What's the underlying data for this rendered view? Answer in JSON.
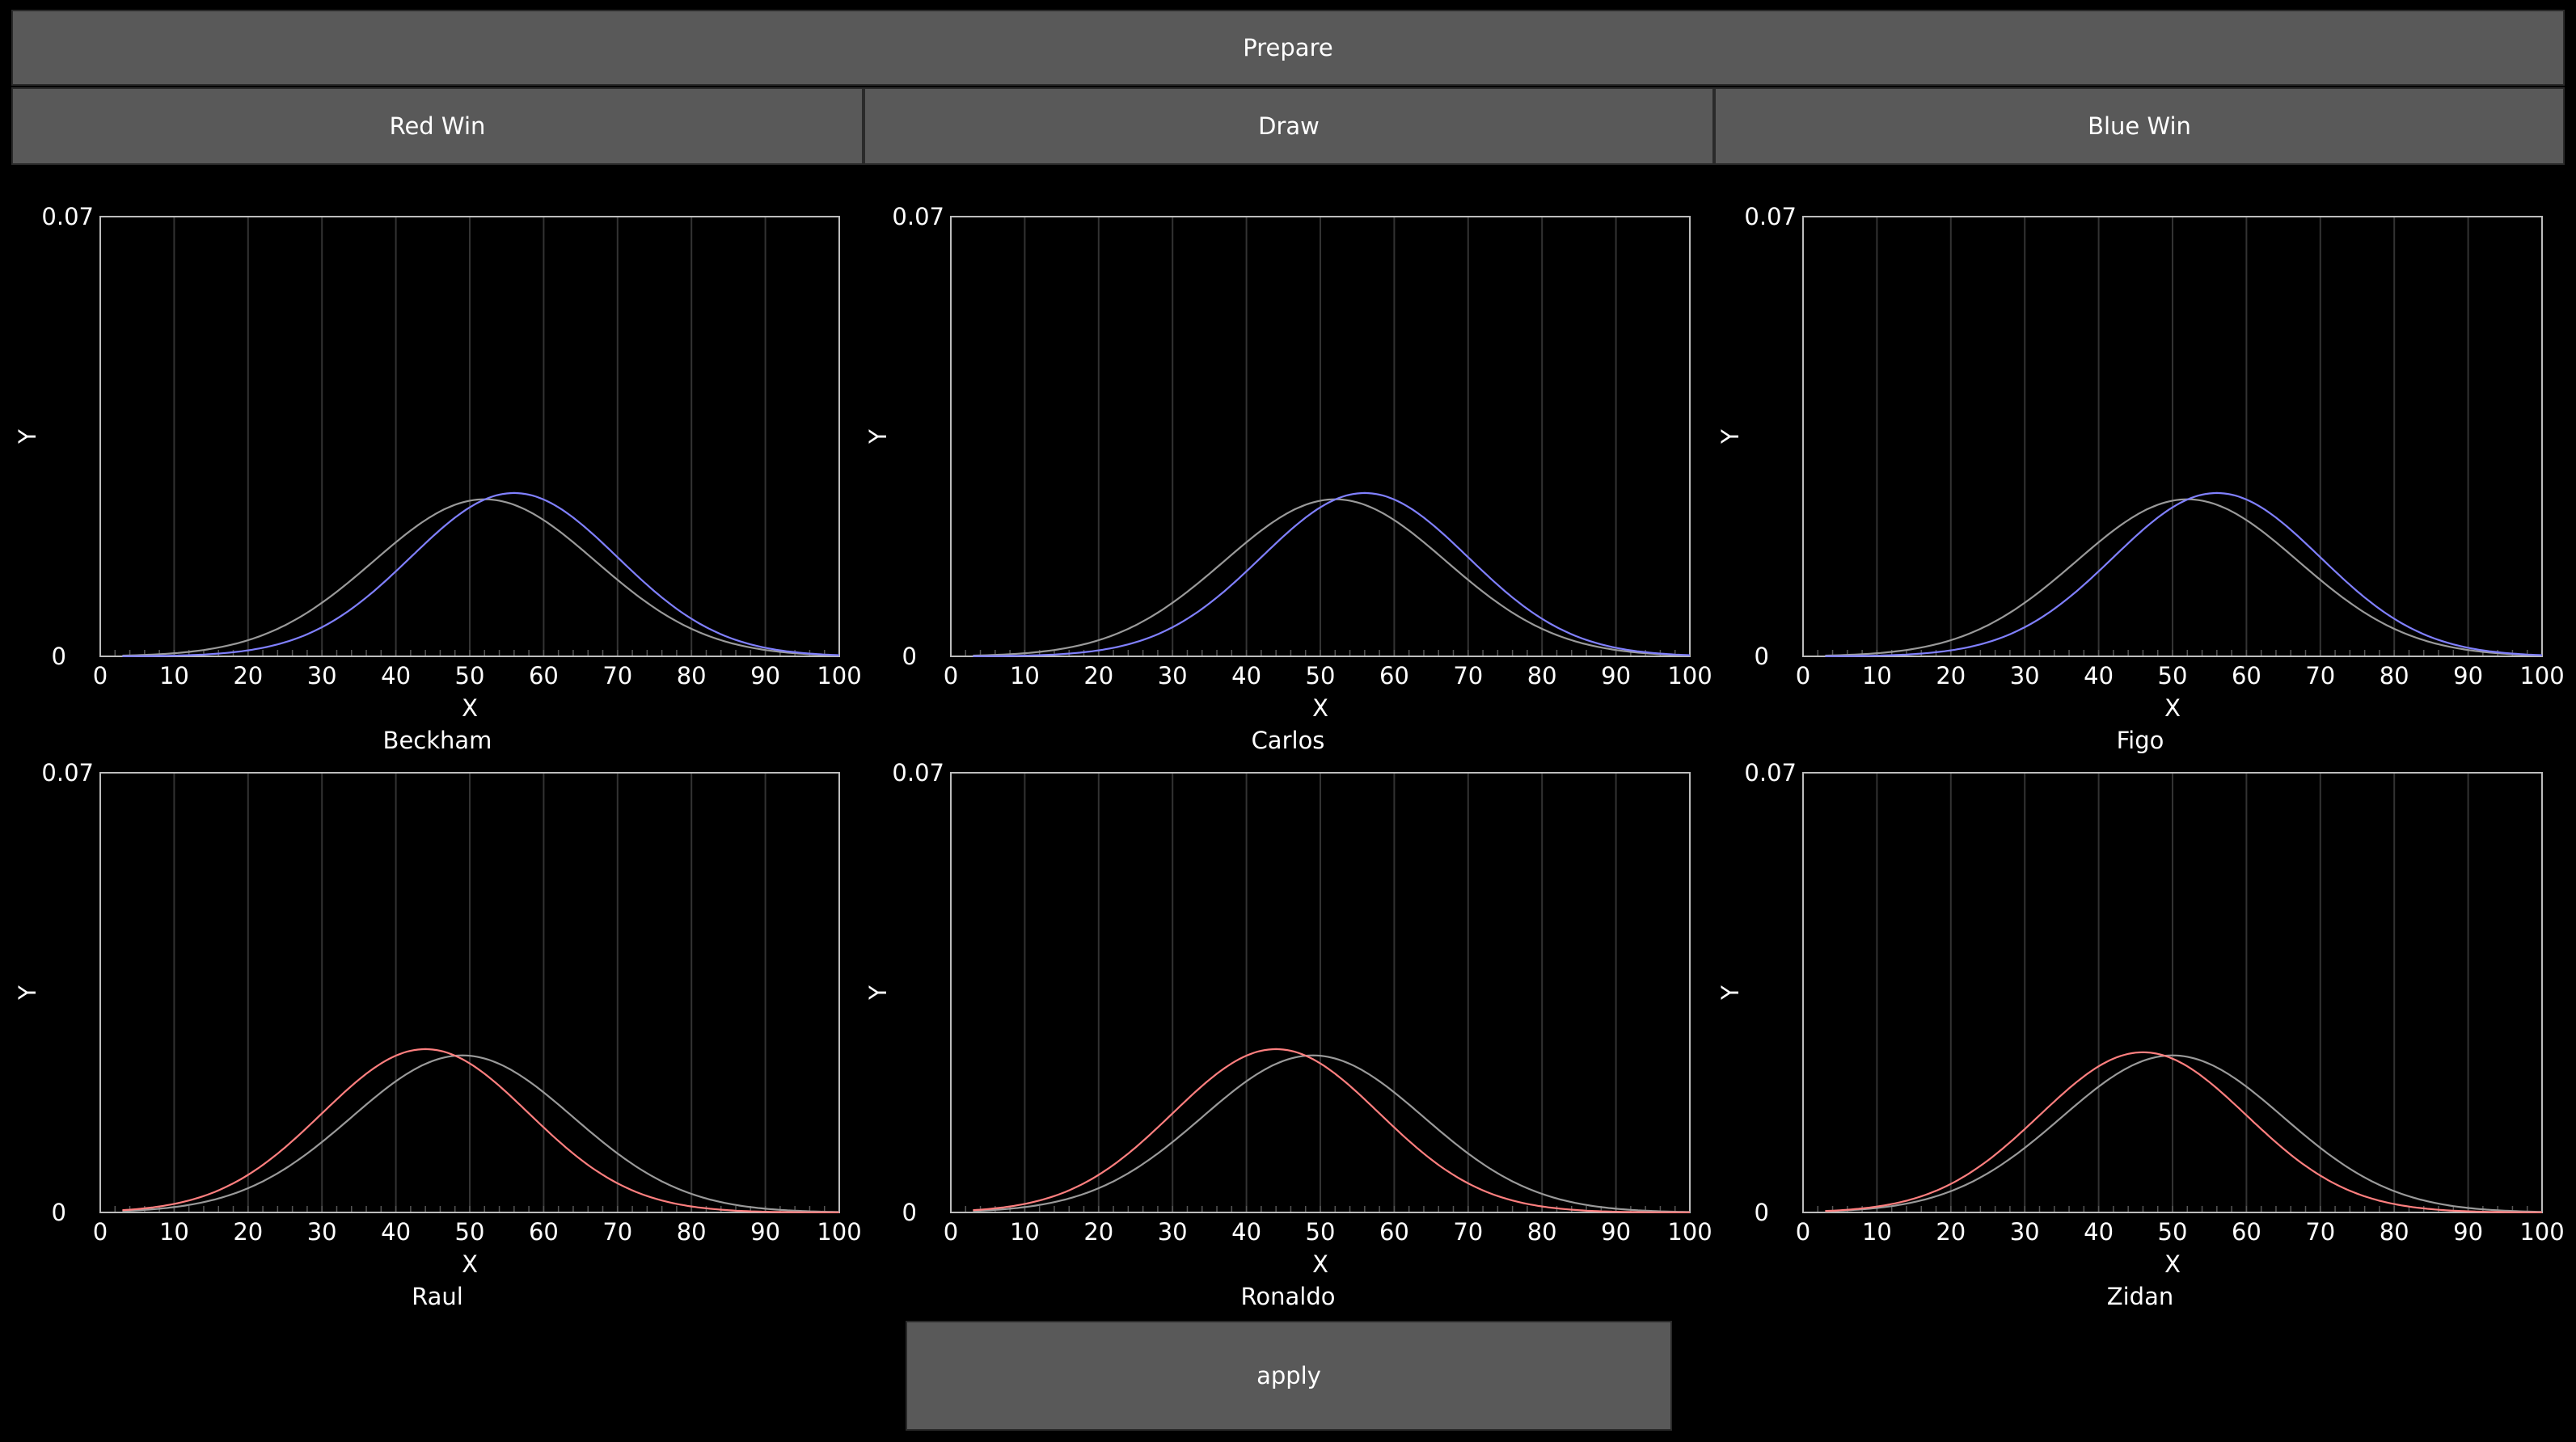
{
  "buttons": {
    "prepare": "Prepare",
    "red_win": "Red Win",
    "draw": "Draw",
    "blue_win": "Blue Win",
    "apply": "apply"
  },
  "colors": {
    "background": "#000000",
    "button_bg": "#595959",
    "gray_curve": "#9a9a9a",
    "blue_curve": "#8080ff",
    "red_curve": "#ff7f7f",
    "axis": "#bdbdbd",
    "grid": "#333333"
  },
  "chart_data": [
    {
      "type": "line",
      "title": "Beckham",
      "xlabel": "X",
      "ylabel": "Y",
      "xlim": [
        0,
        100
      ],
      "ylim": [
        0,
        0.07
      ],
      "x_ticks": [
        "0",
        "10",
        "20",
        "30",
        "40",
        "50",
        "60",
        "70",
        "80",
        "90",
        "100"
      ],
      "y_ticks": [
        "0",
        "0.07"
      ],
      "series": [
        {
          "color": "gray",
          "mean": 52,
          "sd": 15,
          "peak": 0.025
        },
        {
          "color": "blue",
          "mean": 56,
          "sd": 14,
          "peak": 0.026
        }
      ]
    },
    {
      "type": "line",
      "title": "Carlos",
      "xlabel": "X",
      "ylabel": "Y",
      "xlim": [
        0,
        100
      ],
      "ylim": [
        0,
        0.07
      ],
      "x_ticks": [
        "0",
        "10",
        "20",
        "30",
        "40",
        "50",
        "60",
        "70",
        "80",
        "90",
        "100"
      ],
      "y_ticks": [
        "0",
        "0.07"
      ],
      "series": [
        {
          "color": "gray",
          "mean": 52,
          "sd": 15,
          "peak": 0.025
        },
        {
          "color": "blue",
          "mean": 56,
          "sd": 14,
          "peak": 0.026
        }
      ]
    },
    {
      "type": "line",
      "title": "Figo",
      "xlabel": "X",
      "ylabel": "Y",
      "xlim": [
        0,
        100
      ],
      "ylim": [
        0,
        0.07
      ],
      "x_ticks": [
        "0",
        "10",
        "20",
        "30",
        "40",
        "50",
        "60",
        "70",
        "80",
        "90",
        "100"
      ],
      "y_ticks": [
        "0",
        "0.07"
      ],
      "series": [
        {
          "color": "gray",
          "mean": 52,
          "sd": 15,
          "peak": 0.025
        },
        {
          "color": "blue",
          "mean": 56,
          "sd": 14,
          "peak": 0.026
        }
      ]
    },
    {
      "type": "line",
      "title": "Raul",
      "xlabel": "X",
      "ylabel": "Y",
      "xlim": [
        0,
        100
      ],
      "ylim": [
        0,
        0.07
      ],
      "x_ticks": [
        "0",
        "10",
        "20",
        "30",
        "40",
        "50",
        "60",
        "70",
        "80",
        "90",
        "100"
      ],
      "y_ticks": [
        "0",
        "0.07"
      ],
      "series": [
        {
          "color": "gray",
          "mean": 49,
          "sd": 15,
          "peak": 0.025
        },
        {
          "color": "red",
          "mean": 44,
          "sd": 14,
          "peak": 0.026
        }
      ]
    },
    {
      "type": "line",
      "title": "Ronaldo",
      "xlabel": "X",
      "ylabel": "Y",
      "xlim": [
        0,
        100
      ],
      "ylim": [
        0,
        0.07
      ],
      "x_ticks": [
        "0",
        "10",
        "20",
        "30",
        "40",
        "50",
        "60",
        "70",
        "80",
        "90",
        "100"
      ],
      "y_ticks": [
        "0",
        "0.07"
      ],
      "series": [
        {
          "color": "gray",
          "mean": 49,
          "sd": 15,
          "peak": 0.025
        },
        {
          "color": "red",
          "mean": 44,
          "sd": 14,
          "peak": 0.026
        }
      ]
    },
    {
      "type": "line",
      "title": "Zidan",
      "xlabel": "X",
      "ylabel": "Y",
      "xlim": [
        0,
        100
      ],
      "ylim": [
        0,
        0.07
      ],
      "x_ticks": [
        "0",
        "10",
        "20",
        "30",
        "40",
        "50",
        "60",
        "70",
        "80",
        "90",
        "100"
      ],
      "y_ticks": [
        "0",
        "0.07"
      ],
      "series": [
        {
          "color": "gray",
          "mean": 50,
          "sd": 15,
          "peak": 0.025
        },
        {
          "color": "red",
          "mean": 46,
          "sd": 14,
          "peak": 0.0255
        }
      ]
    }
  ]
}
